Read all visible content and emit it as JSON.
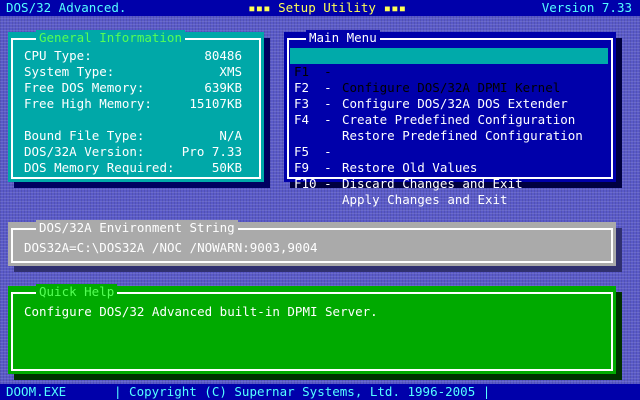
{
  "header": {
    "left": "DOS/32 Advanced.",
    "center": "▪▪▪ Setup Utility ▪▪▪",
    "right": "Version 7.33"
  },
  "general_info": {
    "title": "General Information",
    "rows": [
      {
        "label": "CPU Type:",
        "value": "80486"
      },
      {
        "label": "System Type:",
        "value": "XMS"
      },
      {
        "label": "Free DOS Memory:",
        "value": "639KB"
      },
      {
        "label": "Free High Memory:",
        "value": "15107KB"
      },
      {
        "label": "Bound File Type:",
        "value": "N/A"
      },
      {
        "label": "DOS/32A Version:",
        "value": "Pro 7.33"
      },
      {
        "label": "DOS Memory Required:",
        "value": "50KB"
      }
    ]
  },
  "main_menu": {
    "title": "Main Menu",
    "items": [
      {
        "key": "F1  -",
        "label": "Configure DOS/32A DPMI Kernel"
      },
      {
        "key": "F2  -",
        "label": "Configure DOS/32A DOS Extender"
      },
      {
        "key": "F3  -",
        "label": "Create Predefined Configuration"
      },
      {
        "key": "F4  -",
        "label": "Restore Predefined Configuration"
      },
      {
        "key": "F5  -",
        "label": "Restore Old Values"
      },
      {
        "key": "F9  -",
        "label": "Discard Changes and Exit"
      },
      {
        "key": "F10 -",
        "label": "Apply Changes and Exit"
      }
    ]
  },
  "environment": {
    "title": "DOS/32A Environment String",
    "value": "DOS32A=C:\\DOS32A /NOC /NOWARN:9003,9004"
  },
  "quick_help": {
    "title": "Quick Help",
    "text": "Configure DOS/32 Advanced built-in DPMI Server."
  },
  "footer": {
    "file": "DOOM.EXE",
    "copyright": "| Copyright (C) Supernar Systems, Ltd. 1996-2005 |"
  }
}
